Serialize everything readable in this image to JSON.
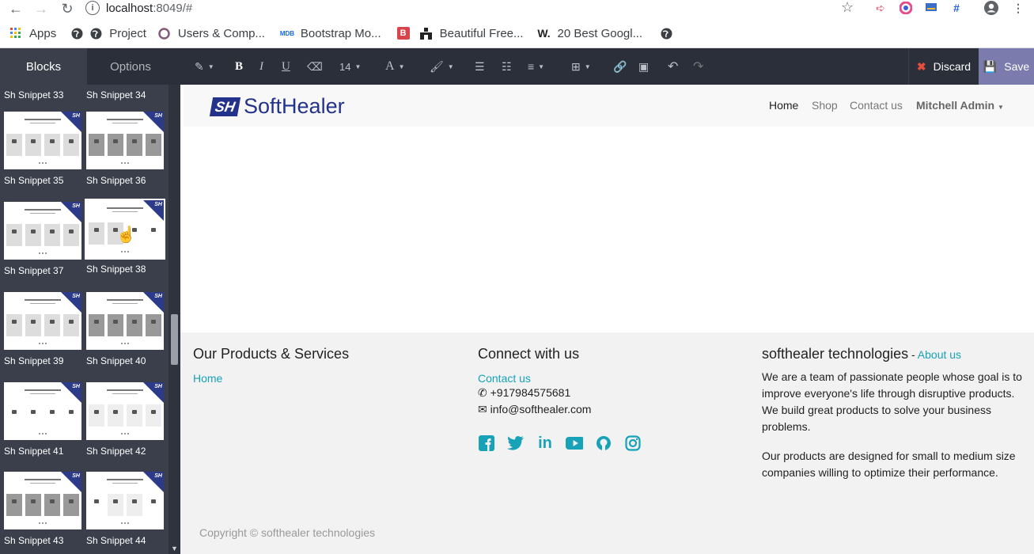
{
  "browser": {
    "url_host": "localhost",
    "url_rest": ":8049/#",
    "bookmarks": [
      {
        "label": "Apps",
        "icon": "apps-grid-icon"
      },
      {
        "label": "",
        "icon": "globe-icon"
      },
      {
        "label": "Project",
        "icon": "globe-icon"
      },
      {
        "label": "Users & Comp...",
        "icon": "odoo-icon"
      },
      {
        "label": "Bootstrap Mo...",
        "icon": "mdb-icon"
      },
      {
        "label": "Beautiful Free...",
        "icon": "b-icon"
      },
      {
        "label": "Beautiful Free...",
        "icon": "templates-icon"
      },
      {
        "label": "20 Best Googl...",
        "icon": "w-icon"
      },
      {
        "label": "",
        "icon": "globe-icon"
      }
    ]
  },
  "editor": {
    "tab_blocks": "Blocks",
    "tab_options": "Options",
    "font_size": "14",
    "discard_label": "Discard",
    "save_label": "Save"
  },
  "sidebar": {
    "snippets": [
      "Sh Snippet 33",
      "Sh Snippet 34",
      "Sh Snippet 35",
      "Sh Snippet 36",
      "Sh Snippet 37",
      "Sh Snippet 38",
      "Sh Snippet 39",
      "Sh Snippet 40",
      "Sh Snippet 41",
      "Sh Snippet 42",
      "Sh Snippet 43",
      "Sh Snippet 44"
    ]
  },
  "site": {
    "logo_mark": "SH",
    "logo_name": "SoftHealer",
    "menu": [
      "Home",
      "Shop",
      "Contact us"
    ],
    "user": "Mitchell Admin",
    "footer": {
      "col1_title": "Our Products & Services",
      "col1_link": "Home",
      "col2_title": "Connect with us",
      "col2_link": "Contact us",
      "phone": "+917984575681",
      "email": "info@softhealer.com",
      "col3_title": "softhealer technologies",
      "col3_dash": " - ",
      "col3_link": "About us",
      "about_p1": "We are a team of passionate people whose goal is to improve everyone's life through disruptive products. We build great products to solve your business problems.",
      "about_p2": "Our products are designed for small to medium size companies willing to optimize their performance.",
      "copyright": "Copyright © softhealer technologies"
    }
  },
  "colors": {
    "accent_link": "#17a2b8",
    "save_bg": "#7c7bad",
    "editor_bg": "#2b2f3a",
    "sidebar_bg": "#3a3f4b",
    "brand_blue": "#23328b"
  }
}
